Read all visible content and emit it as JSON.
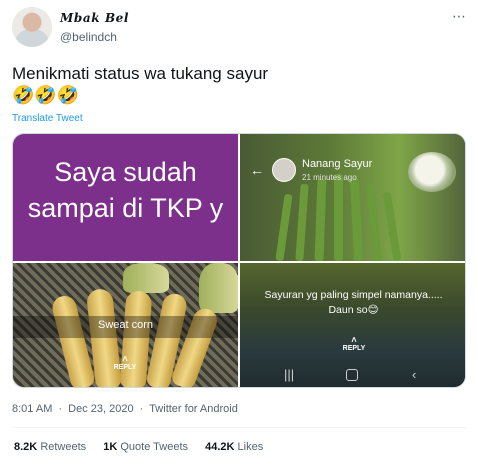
{
  "author": {
    "display_name": "Mbak Bel",
    "handle": "@belindch"
  },
  "more_icon": "⋯",
  "tweet": {
    "text": "Menikmati status wa tukang sayur",
    "emojis": "🤣🤣🤣",
    "translate_label": "Translate Tweet"
  },
  "media": {
    "top_left": {
      "big_text": "Saya sudah sampai di TKP y",
      "background": "#7d2f8c"
    },
    "top_right": {
      "profile_name": "Nanang Sayur",
      "time_ago": "21 minutes ago"
    },
    "bottom_left": {
      "caption": "Sweat corn",
      "reply_label": "REPLY"
    },
    "bottom_right": {
      "message_line1": "Sayuran yg paling simpel namanya.....",
      "message_line2": "Daun so😊",
      "reply_label": "REPLY"
    }
  },
  "meta": {
    "time": "8:01 AM",
    "date": "Dec 23, 2020",
    "source": "Twitter for Android",
    "separator": "·"
  },
  "stats": {
    "retweets_count": "8.2K",
    "retweets_label": "Retweets",
    "quote_count": "1K",
    "quote_label": "Quote Tweets",
    "likes_count": "44.2K",
    "likes_label": "Likes"
  },
  "colors": {
    "link": "#1d9bf0",
    "secondary_text": "#536471",
    "primary_text": "#0f1419"
  }
}
